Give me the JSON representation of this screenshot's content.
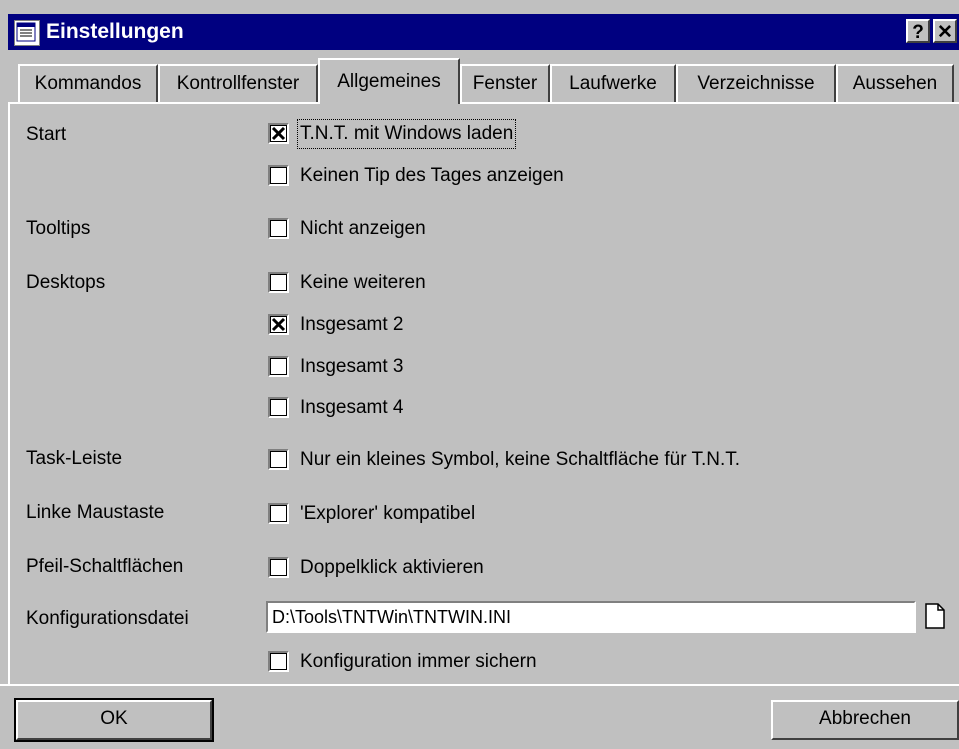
{
  "window": {
    "title": "Einstellungen",
    "help_label": "?",
    "close_label": "✕"
  },
  "tabs": [
    {
      "label": "Kommandos",
      "active": false
    },
    {
      "label": "Kontrollfenster",
      "active": false
    },
    {
      "label": "Allgemeines",
      "active": true
    },
    {
      "label": "Fenster",
      "active": false
    },
    {
      "label": "Laufwerke",
      "active": false
    },
    {
      "label": "Verzeichnisse",
      "active": false
    },
    {
      "label": "Aussehen",
      "active": false
    }
  ],
  "sections": {
    "start": "Start",
    "tooltips": "Tooltips",
    "desktops": "Desktops",
    "taskleiste": "Task-Leiste",
    "maus": "Linke Maustaste",
    "pfeil": "Pfeil-Schaltflächen",
    "config": "Konfigurationsdatei"
  },
  "options": {
    "tnt_windows": {
      "label": "T.N.T. mit Windows laden",
      "checked": true
    },
    "kein_tip": {
      "label": "Keinen Tip des Tages anzeigen",
      "checked": false
    },
    "nicht_anzeigen": {
      "label": "Nicht anzeigen",
      "checked": false
    },
    "keine_weiteren": {
      "label": "Keine weiteren",
      "checked": false
    },
    "insgesamt_2": {
      "label": "Insgesamt 2",
      "checked": true
    },
    "insgesamt_3": {
      "label": "Insgesamt 3",
      "checked": false
    },
    "insgesamt_4": {
      "label": "Insgesamt 4",
      "checked": false
    },
    "nur_symbol": {
      "label": "Nur ein kleines Symbol, keine Schaltfläche für T.N.T.",
      "checked": false
    },
    "explorer": {
      "label": "'Explorer' kompatibel",
      "checked": false
    },
    "doppelklick": {
      "label": "Doppelklick aktivieren",
      "checked": false
    },
    "immer_sichern": {
      "label": "Konfiguration immer sichern",
      "checked": false
    }
  },
  "config_path": "D:\\Tools\\TNTWin\\TNTWIN.INI",
  "buttons": {
    "ok": "OK",
    "cancel": "Abbrechen"
  },
  "colors": {
    "titlebar": "#000080",
    "face": "#c0c0c0"
  }
}
